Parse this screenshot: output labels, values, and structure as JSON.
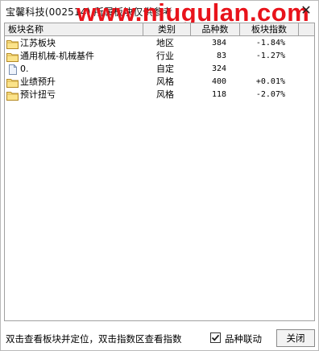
{
  "window": {
    "title": "宝馨科技(002514)  所属板块仅供参考",
    "watermark": "www.niugulan.com",
    "close_glyph": "✕"
  },
  "table": {
    "columns": [
      "板块名称",
      "类别",
      "品种数",
      "板块指数"
    ],
    "rows": [
      {
        "icon": "folder-icon",
        "name": "江苏板块",
        "category": "地区",
        "count": "384",
        "index": "-1.84%"
      },
      {
        "icon": "folder-icon",
        "name": "通用机械-机械基件",
        "category": "行业",
        "count": "83",
        "index": "-1.27%"
      },
      {
        "icon": "document-icon",
        "name": "0.",
        "category": "自定",
        "count": "324",
        "index": ""
      },
      {
        "icon": "folder-icon",
        "name": "业绩预升",
        "category": "风格",
        "count": "400",
        "index": "+0.01%"
      },
      {
        "icon": "folder-icon",
        "name": "预计扭亏",
        "category": "风格",
        "count": "118",
        "index": "-2.07%"
      }
    ]
  },
  "footer": {
    "hint": "双击查看板块并定位，双击指数区查看指数",
    "checkbox_label": "品种联动",
    "checkbox_checked": true,
    "close_button": "关闭"
  }
}
